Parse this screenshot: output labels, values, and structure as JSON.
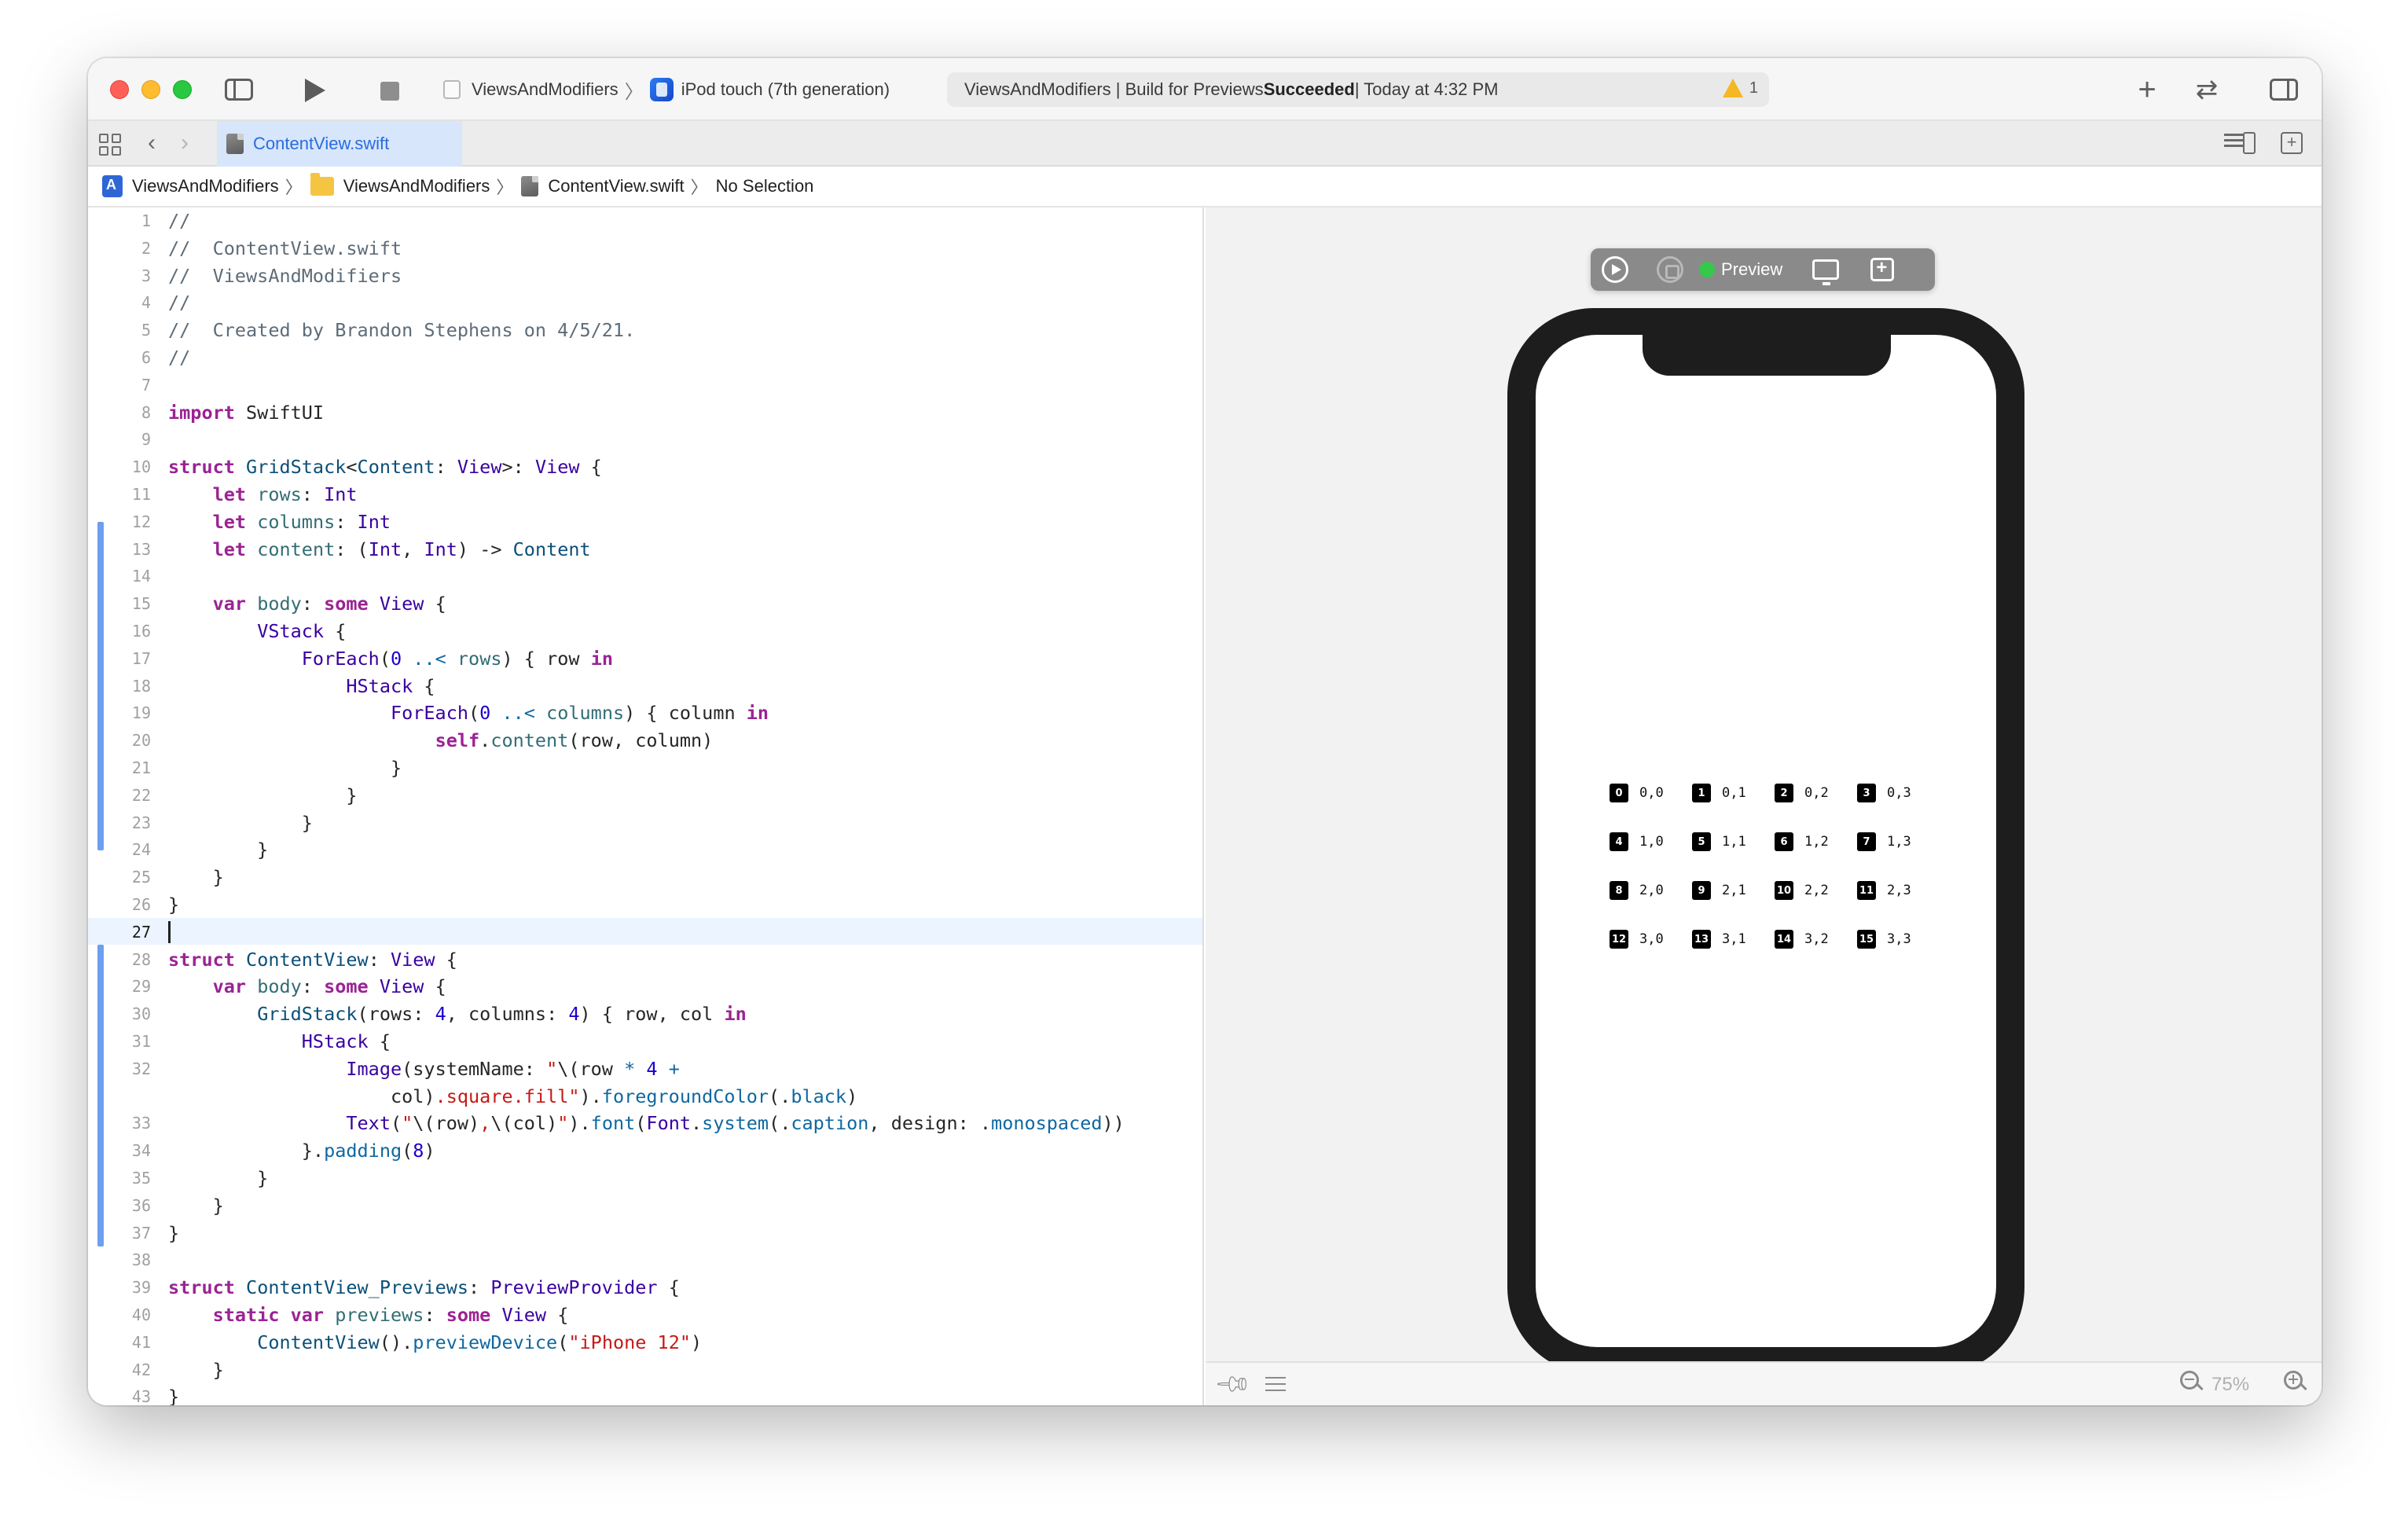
{
  "toolbar": {
    "scheme_name": "ViewsAndModifiers",
    "scheme_separator": "〉",
    "device_name": "iPod touch (7th generation)",
    "activity_prefix": "ViewsAndModifiers | Build for Previews ",
    "activity_status": "Succeeded",
    "activity_suffix": " | Today at 4:32 PM",
    "warning_count": "1",
    "add_label": "+",
    "swap_label": "⇄"
  },
  "tabbar": {
    "back_icon": "‹",
    "forward_icon": "›",
    "active_tab": "ContentView.swift"
  },
  "jumpbar": {
    "project": "ViewsAndModifiers",
    "group": "ViewsAndModifiers",
    "file": "ContentView.swift",
    "selection": "No Selection",
    "sep": "〉"
  },
  "editor": {
    "current_line": 27,
    "lines": [
      {
        "n": 1,
        "html": "<span class=\"cm\">//</span>"
      },
      {
        "n": 2,
        "html": "<span class=\"cm\">//  ContentView.swift</span>"
      },
      {
        "n": 3,
        "html": "<span class=\"cm\">//  ViewsAndModifiers</span>"
      },
      {
        "n": 4,
        "html": "<span class=\"cm\">//</span>"
      },
      {
        "n": 5,
        "html": "<span class=\"cm\">//  Created by Brandon Stephens on 4/5/21.</span>"
      },
      {
        "n": 6,
        "html": "<span class=\"cm\">//</span>"
      },
      {
        "n": 7,
        "html": ""
      },
      {
        "n": 8,
        "html": "<span class=\"kw\">import</span> SwiftUI"
      },
      {
        "n": 9,
        "html": ""
      },
      {
        "n": 10,
        "html": "<span class=\"kw\">struct</span> <span class=\"tyu\">GridStack</span>&lt;<span class=\"tyu\">Content</span>: <span class=\"ty\">View</span>&gt;: <span class=\"ty\">View</span> {"
      },
      {
        "n": 11,
        "html": "    <span class=\"kw\">let</span> <span class=\"fn\">rows</span>: <span class=\"ty\">Int</span>"
      },
      {
        "n": 12,
        "html": "    <span class=\"kw\">let</span> <span class=\"fn\">columns</span>: <span class=\"ty\">Int</span>"
      },
      {
        "n": 13,
        "html": "    <span class=\"kw\">let</span> <span class=\"fn\">content</span>: (<span class=\"ty\">Int</span>, <span class=\"ty\">Int</span>) -&gt; <span class=\"tyu\">Content</span>"
      },
      {
        "n": 14,
        "html": ""
      },
      {
        "n": 15,
        "html": "    <span class=\"kw\">var</span> <span class=\"fn\">body</span>: <span class=\"kw\">some</span> <span class=\"ty\">View</span> {"
      },
      {
        "n": 16,
        "html": "        <span class=\"ty\">VStack</span> {"
      },
      {
        "n": 17,
        "html": "            <span class=\"ty\">ForEach</span>(<span class=\"num\">0</span> <span class=\"ref\">..&lt;</span> <span class=\"fn\">rows</span>) { row <span class=\"kw\">in</span>"
      },
      {
        "n": 18,
        "html": "                <span class=\"ty\">HStack</span> {"
      },
      {
        "n": 19,
        "html": "                    <span class=\"ty\">ForEach</span>(<span class=\"num\">0</span> <span class=\"ref\">..&lt;</span> <span class=\"fn\">columns</span>) { column <span class=\"kw\">in</span>"
      },
      {
        "n": 20,
        "html": "                        <span class=\"kw\">self</span>.<span class=\"fn\">content</span>(row, column)"
      },
      {
        "n": 21,
        "html": "                    }"
      },
      {
        "n": 22,
        "html": "                }"
      },
      {
        "n": 23,
        "html": "            }"
      },
      {
        "n": 24,
        "html": "        }"
      },
      {
        "n": 25,
        "html": "    }"
      },
      {
        "n": 26,
        "html": "}"
      },
      {
        "n": 27,
        "html": ""
      },
      {
        "n": 28,
        "html": "<span class=\"kw\">struct</span> <span class=\"tyu\">ContentView</span>: <span class=\"ty\">View</span> {"
      },
      {
        "n": 29,
        "html": "    <span class=\"kw\">var</span> <span class=\"fn\">body</span>: <span class=\"kw\">some</span> <span class=\"ty\">View</span> {"
      },
      {
        "n": 30,
        "html": "        <span class=\"tyu\">GridStack</span>(rows: <span class=\"num\">4</span>, columns: <span class=\"num\">4</span>) { row, col <span class=\"kw\">in</span>"
      },
      {
        "n": 31,
        "html": "            <span class=\"ty\">HStack</span> {"
      },
      {
        "n": 32,
        "html": "                <span class=\"ty\">Image</span>(systemName: <span class=\"str\">\"</span>\\(row <span class=\"ref\">*</span> <span class=\"num\">4</span> <span class=\"ref\">+</span>"
      },
      {
        "n": "",
        "html": "                    col)<span class=\"str\">.square.fill\"</span>).<span class=\"ref\">foregroundColor</span>(.<span class=\"ref\">black</span>)"
      },
      {
        "n": 33,
        "html": "                <span class=\"ty\">Text</span>(<span class=\"str\">\"</span>\\(row)<span class=\"str\">,</span>\\(col)<span class=\"str\">\"</span>).<span class=\"ref\">font</span>(<span class=\"ty\">Font</span>.<span class=\"ref\">system</span>(.<span class=\"ref\">caption</span>, design: .<span class=\"ref\">monospaced</span>))"
      },
      {
        "n": 34,
        "html": "            }.<span class=\"ref\">padding</span>(<span class=\"num\">8</span>)"
      },
      {
        "n": 35,
        "html": "        }"
      },
      {
        "n": 36,
        "html": "    }"
      },
      {
        "n": 37,
        "html": "}"
      },
      {
        "n": 38,
        "html": ""
      },
      {
        "n": 39,
        "html": "<span class=\"kw\">struct</span> <span class=\"tyu\">ContentView_Previews</span>: <span class=\"ty\">PreviewProvider</span> {"
      },
      {
        "n": 40,
        "html": "    <span class=\"kw\">static</span> <span class=\"kw\">var</span> <span class=\"fn\">previews</span>: <span class=\"kw\">some</span> <span class=\"ty\">View</span> {"
      },
      {
        "n": 41,
        "html": "        <span class=\"tyu\">ContentView</span>().<span class=\"ref\">previewDevice</span>(<span class=\"str\">\"iPhone 12\"</span>)"
      },
      {
        "n": 42,
        "html": "    }"
      },
      {
        "n": 43,
        "html": "}"
      },
      {
        "n": 44,
        "html": ""
      }
    ]
  },
  "canvas": {
    "preview_label": "Preview",
    "status_color": "#35c84a",
    "zoom_level": "75%",
    "grid": [
      [
        {
          "icon": "0",
          "text": "0,0"
        },
        {
          "icon": "1",
          "text": "0,1"
        },
        {
          "icon": "2",
          "text": "0,2"
        },
        {
          "icon": "3",
          "text": "0,3"
        }
      ],
      [
        {
          "icon": "4",
          "text": "1,0"
        },
        {
          "icon": "5",
          "text": "1,1"
        },
        {
          "icon": "6",
          "text": "1,2"
        },
        {
          "icon": "7",
          "text": "1,3"
        }
      ],
      [
        {
          "icon": "8",
          "text": "2,0"
        },
        {
          "icon": "9",
          "text": "2,1"
        },
        {
          "icon": "10",
          "text": "2,2"
        },
        {
          "icon": "11",
          "text": "2,3"
        }
      ],
      [
        {
          "icon": "12",
          "text": "3,0"
        },
        {
          "icon": "13",
          "text": "3,1"
        },
        {
          "icon": "14",
          "text": "3,2"
        },
        {
          "icon": "15",
          "text": "3,3"
        }
      ]
    ]
  }
}
